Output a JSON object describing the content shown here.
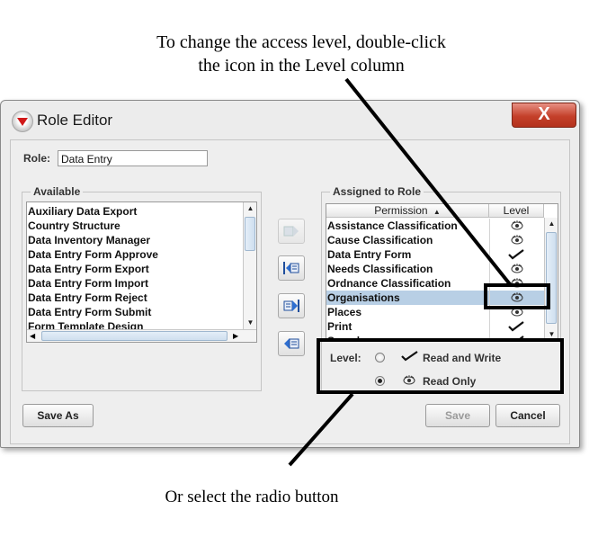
{
  "annotations": {
    "top_line1": "To change the access level, double-click",
    "top_line2": "the icon in the Level column",
    "bottom": "Or select the radio button"
  },
  "window": {
    "title": "Role Editor",
    "close_label": "X"
  },
  "role": {
    "label": "Role:",
    "value": "Data Entry"
  },
  "available": {
    "title": "Available",
    "items": [
      "Auxiliary Data Export",
      "Country Structure",
      "Data Inventory Manager",
      "Data Entry Form Approve",
      "Data Entry Form Export",
      "Data Entry Form Import",
      "Data Entry Form Reject",
      "Data Entry Form Submit",
      "Form Template Design"
    ]
  },
  "assigned": {
    "title": "Assigned to Role",
    "columns": {
      "permission": "Permission",
      "level": "Level"
    },
    "rows": [
      {
        "permission": "Assistance Classification",
        "level": "read-only-eye-icon"
      },
      {
        "permission": "Cause Classification",
        "level": "read-only-eye-icon"
      },
      {
        "permission": "Data Entry Form",
        "level": "read-write-check-icon"
      },
      {
        "permission": "Needs Classification",
        "level": "read-only-eye-icon"
      },
      {
        "permission": "Ordnance Classification",
        "level": "read-only-eye-icon"
      },
      {
        "permission": "Organisations",
        "level": "read-only-eye-icon",
        "selected": true
      },
      {
        "permission": "Places",
        "level": "read-only-eye-icon"
      },
      {
        "permission": "Print",
        "level": "read-write-check-icon"
      },
      {
        "permission": "Search",
        "level": "read-write-check-icon"
      }
    ]
  },
  "level": {
    "label": "Level:",
    "options": [
      {
        "label": "Read and Write",
        "icon": "check-icon",
        "selected": false
      },
      {
        "label": "Read Only",
        "icon": "eye-icon",
        "selected": true
      }
    ]
  },
  "buttons": {
    "save_as": "Save As",
    "save": "Save",
    "cancel": "Cancel"
  },
  "colors": {
    "selection": "#b8cfe5",
    "close_button": "#c4402a"
  }
}
